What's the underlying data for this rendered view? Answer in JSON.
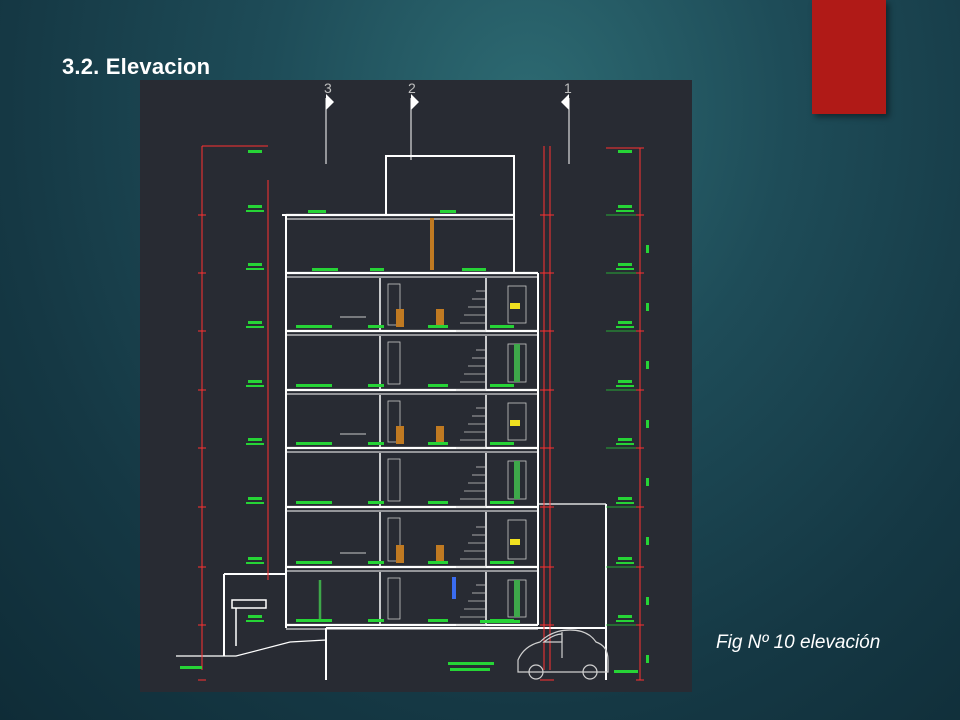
{
  "slide": {
    "title": "3.2. Elevacion",
    "caption": "Fig Nº 10 elevación",
    "accent_color": "#b01a17"
  },
  "drawing": {
    "section_markers": [
      "3",
      "2",
      "1"
    ],
    "colors": {
      "background": "#282b33",
      "walls": "#ffffff",
      "dimensions": "#ff3030",
      "text": "#26d436",
      "stairs": "#c8c8c8",
      "furniture": "#c07a22",
      "accent_yellow": "#f0e020"
    }
  }
}
